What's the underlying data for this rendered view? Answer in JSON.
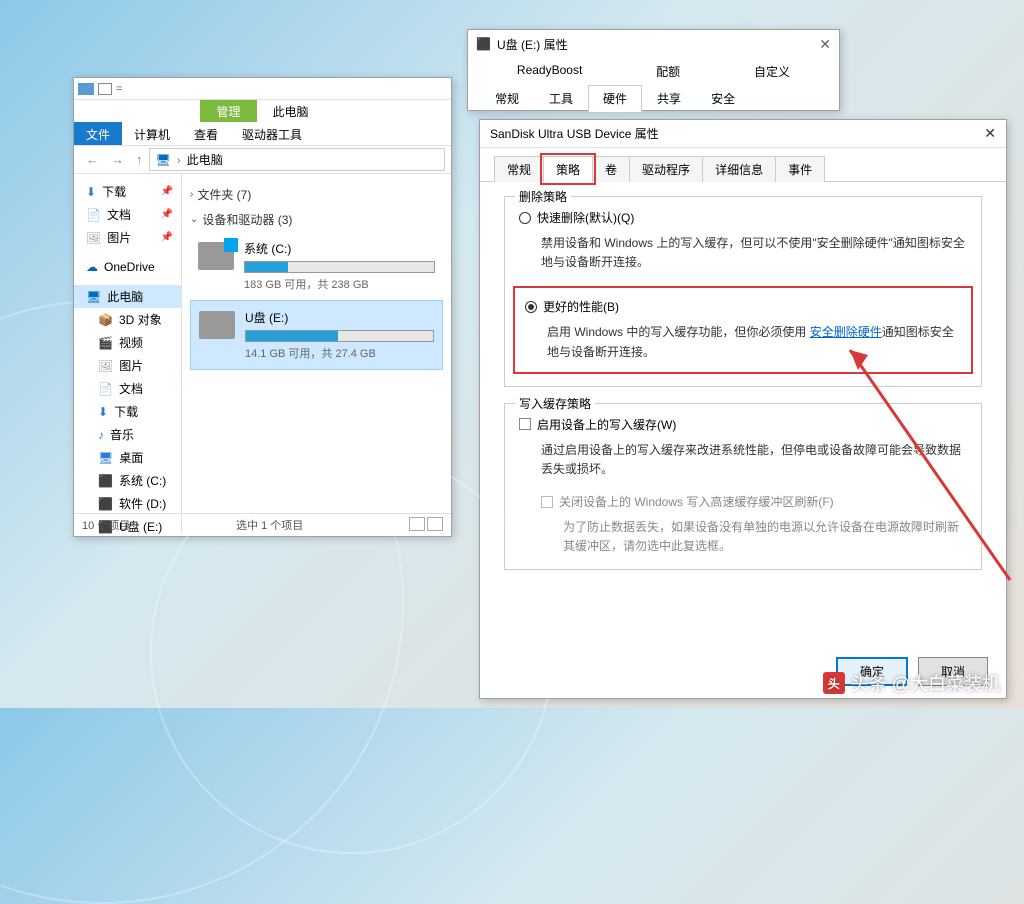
{
  "explorer": {
    "ribbon": {
      "manage": "管理",
      "this_pc": "此电脑"
    },
    "menu": {
      "file": "文件",
      "computer": "计算机",
      "view": "查看",
      "drive_tools": "驱动器工具"
    },
    "address": {
      "label": "此电脑"
    },
    "sidebar": {
      "downloads": "下载",
      "documents": "文档",
      "pictures": "图片",
      "onedrive": "OneDrive",
      "this_pc": "此电脑",
      "objects3d": "3D 对象",
      "videos": "视频",
      "pictures2": "图片",
      "documents2": "文档",
      "downloads2": "下载",
      "music": "音乐",
      "desktop": "桌面",
      "sys_c": "系统 (C:)",
      "soft_d": "软件 (D:)",
      "usb_e": "U盘 (E:)"
    },
    "content": {
      "folders_hdr": "文件夹 (7)",
      "devices_hdr": "设备和驱动器 (3)",
      "drive_c": {
        "name": "系统 (C:)",
        "stats": "183 GB 可用，共 238 GB",
        "fill_pct": 23
      },
      "drive_e": {
        "name": "U盘 (E:)",
        "stats": "14.1 GB 可用，共 27.4 GB",
        "fill_pct": 49
      }
    },
    "status": {
      "left": "10 个项目",
      "right": "选中 1 个项目"
    }
  },
  "props": {
    "title": "U盘 (E:) 属性",
    "tabs_r1": {
      "readyboost": "ReadyBoost",
      "quota": "配额",
      "customize": "自定义"
    },
    "tabs_r2": {
      "general": "常规",
      "tools": "工具",
      "hardware": "硬件",
      "sharing": "共享",
      "security": "安全"
    }
  },
  "devprops": {
    "title": "SanDisk Ultra USB Device 属性",
    "tabs": {
      "general": "常规",
      "policy": "策略",
      "volumes": "卷",
      "driver": "驱动程序",
      "details": "详细信息",
      "events": "事件"
    },
    "removal": {
      "title": "删除策略",
      "quick": "快速删除(默认)(Q)",
      "quick_desc": "禁用设备和 Windows 上的写入缓存，但可以不使用\"安全删除硬件\"通知图标安全地与设备断开连接。",
      "better": "更好的性能(B)",
      "better_desc_pre": "启用 Windows 中的写入缓存功能，但你必须使用",
      "better_link": "安全删除硬件",
      "better_desc_post": "通知图标安全地与设备断开连接。"
    },
    "writecache": {
      "title": "写入缓存策略",
      "enable": "启用设备上的写入缓存(W)",
      "enable_desc": "通过启用设备上的写入缓存来改进系统性能，但停电或设备故障可能会导致数据丢失或损坏。",
      "flush": "关闭设备上的 Windows 写入高速缓存缓冲区刷新(F)",
      "flush_desc": "为了防止数据丢失，如果设备没有单独的电源以允许设备在电源故障时刷新其缓冲区，请勿选中此复选框。"
    },
    "buttons": {
      "ok": "确定",
      "cancel": "取消"
    }
  },
  "watermark": "头条 @大白菜装机"
}
